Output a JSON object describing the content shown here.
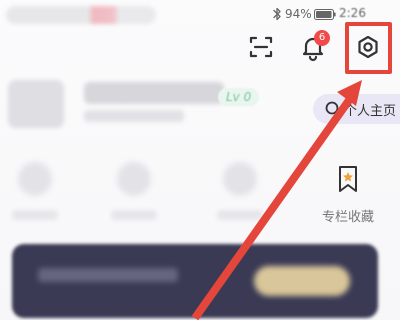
{
  "status_bar": {
    "battery_percent": "94%",
    "time": "2:26",
    "bluetooth_icon": "bluetooth-icon",
    "battery_icon": "battery-icon"
  },
  "header": {
    "scan_icon": "scan-icon",
    "bell_icon": "bell-icon",
    "notification_count": "6",
    "settings_icon": "settings-icon"
  },
  "profile": {
    "level_tag": "Lv 0",
    "homepage_label": "个人主页",
    "homepage_icon": "homepage-icon"
  },
  "shortcuts": {
    "favorites_label": "专栏收藏",
    "favorites_icon": "bookmark-star-icon"
  },
  "annotation": {
    "highlight_color": "#e5463c"
  },
  "colors": {
    "accent_red": "#e5463c",
    "badge_red": "#f24a4a",
    "level_green": "#7cc49c",
    "pill_bg": "#e9e7f6",
    "banner_dark": "#3a3a55"
  }
}
